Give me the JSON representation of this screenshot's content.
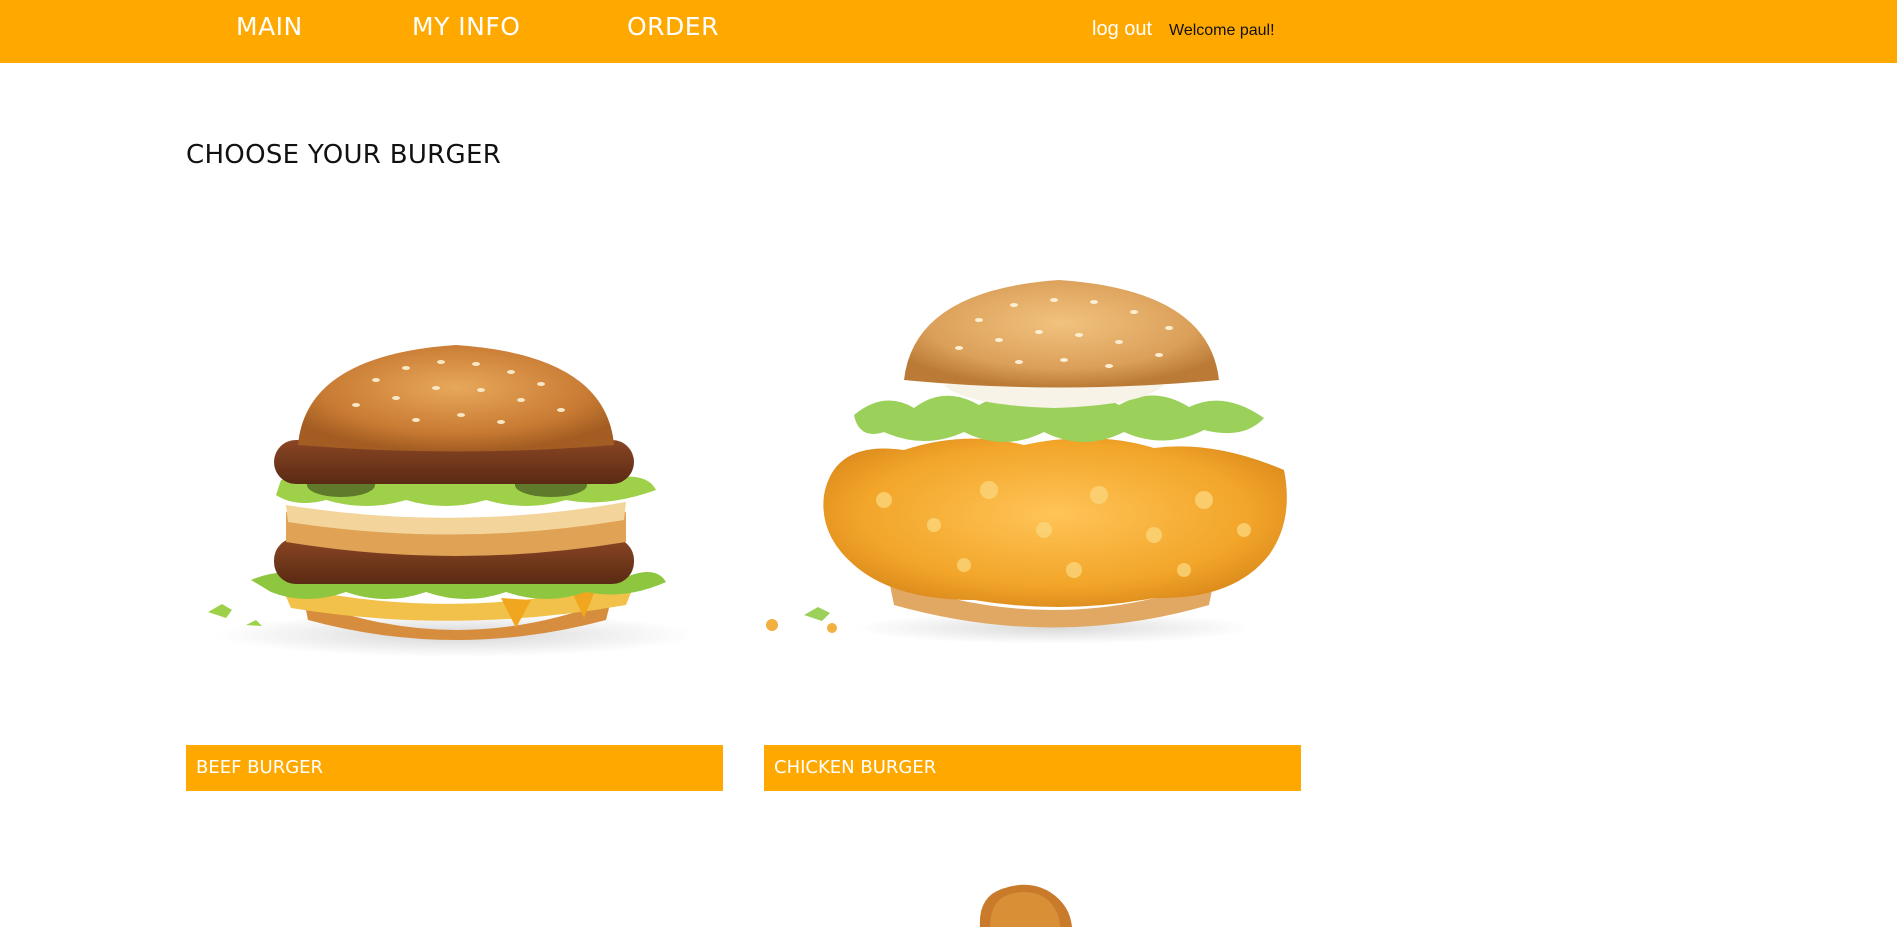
{
  "nav": {
    "items": [
      {
        "label": "MAIN"
      },
      {
        "label": "MY INFO"
      },
      {
        "label": "ORDER"
      }
    ],
    "logout_label": "log out",
    "welcome_text": "Welcome paul!"
  },
  "main": {
    "title": "CHOOSE YOUR BURGER",
    "products": [
      {
        "label": "BEEF BURGER",
        "image": "beef-burger-photo"
      },
      {
        "label": "CHICKEN BURGER",
        "image": "chicken-burger-photo"
      }
    ],
    "next_row_image": "nugget-photo"
  },
  "colors": {
    "accent": "#ffa800",
    "text": "#111111",
    "label_text": "#ffffff"
  }
}
